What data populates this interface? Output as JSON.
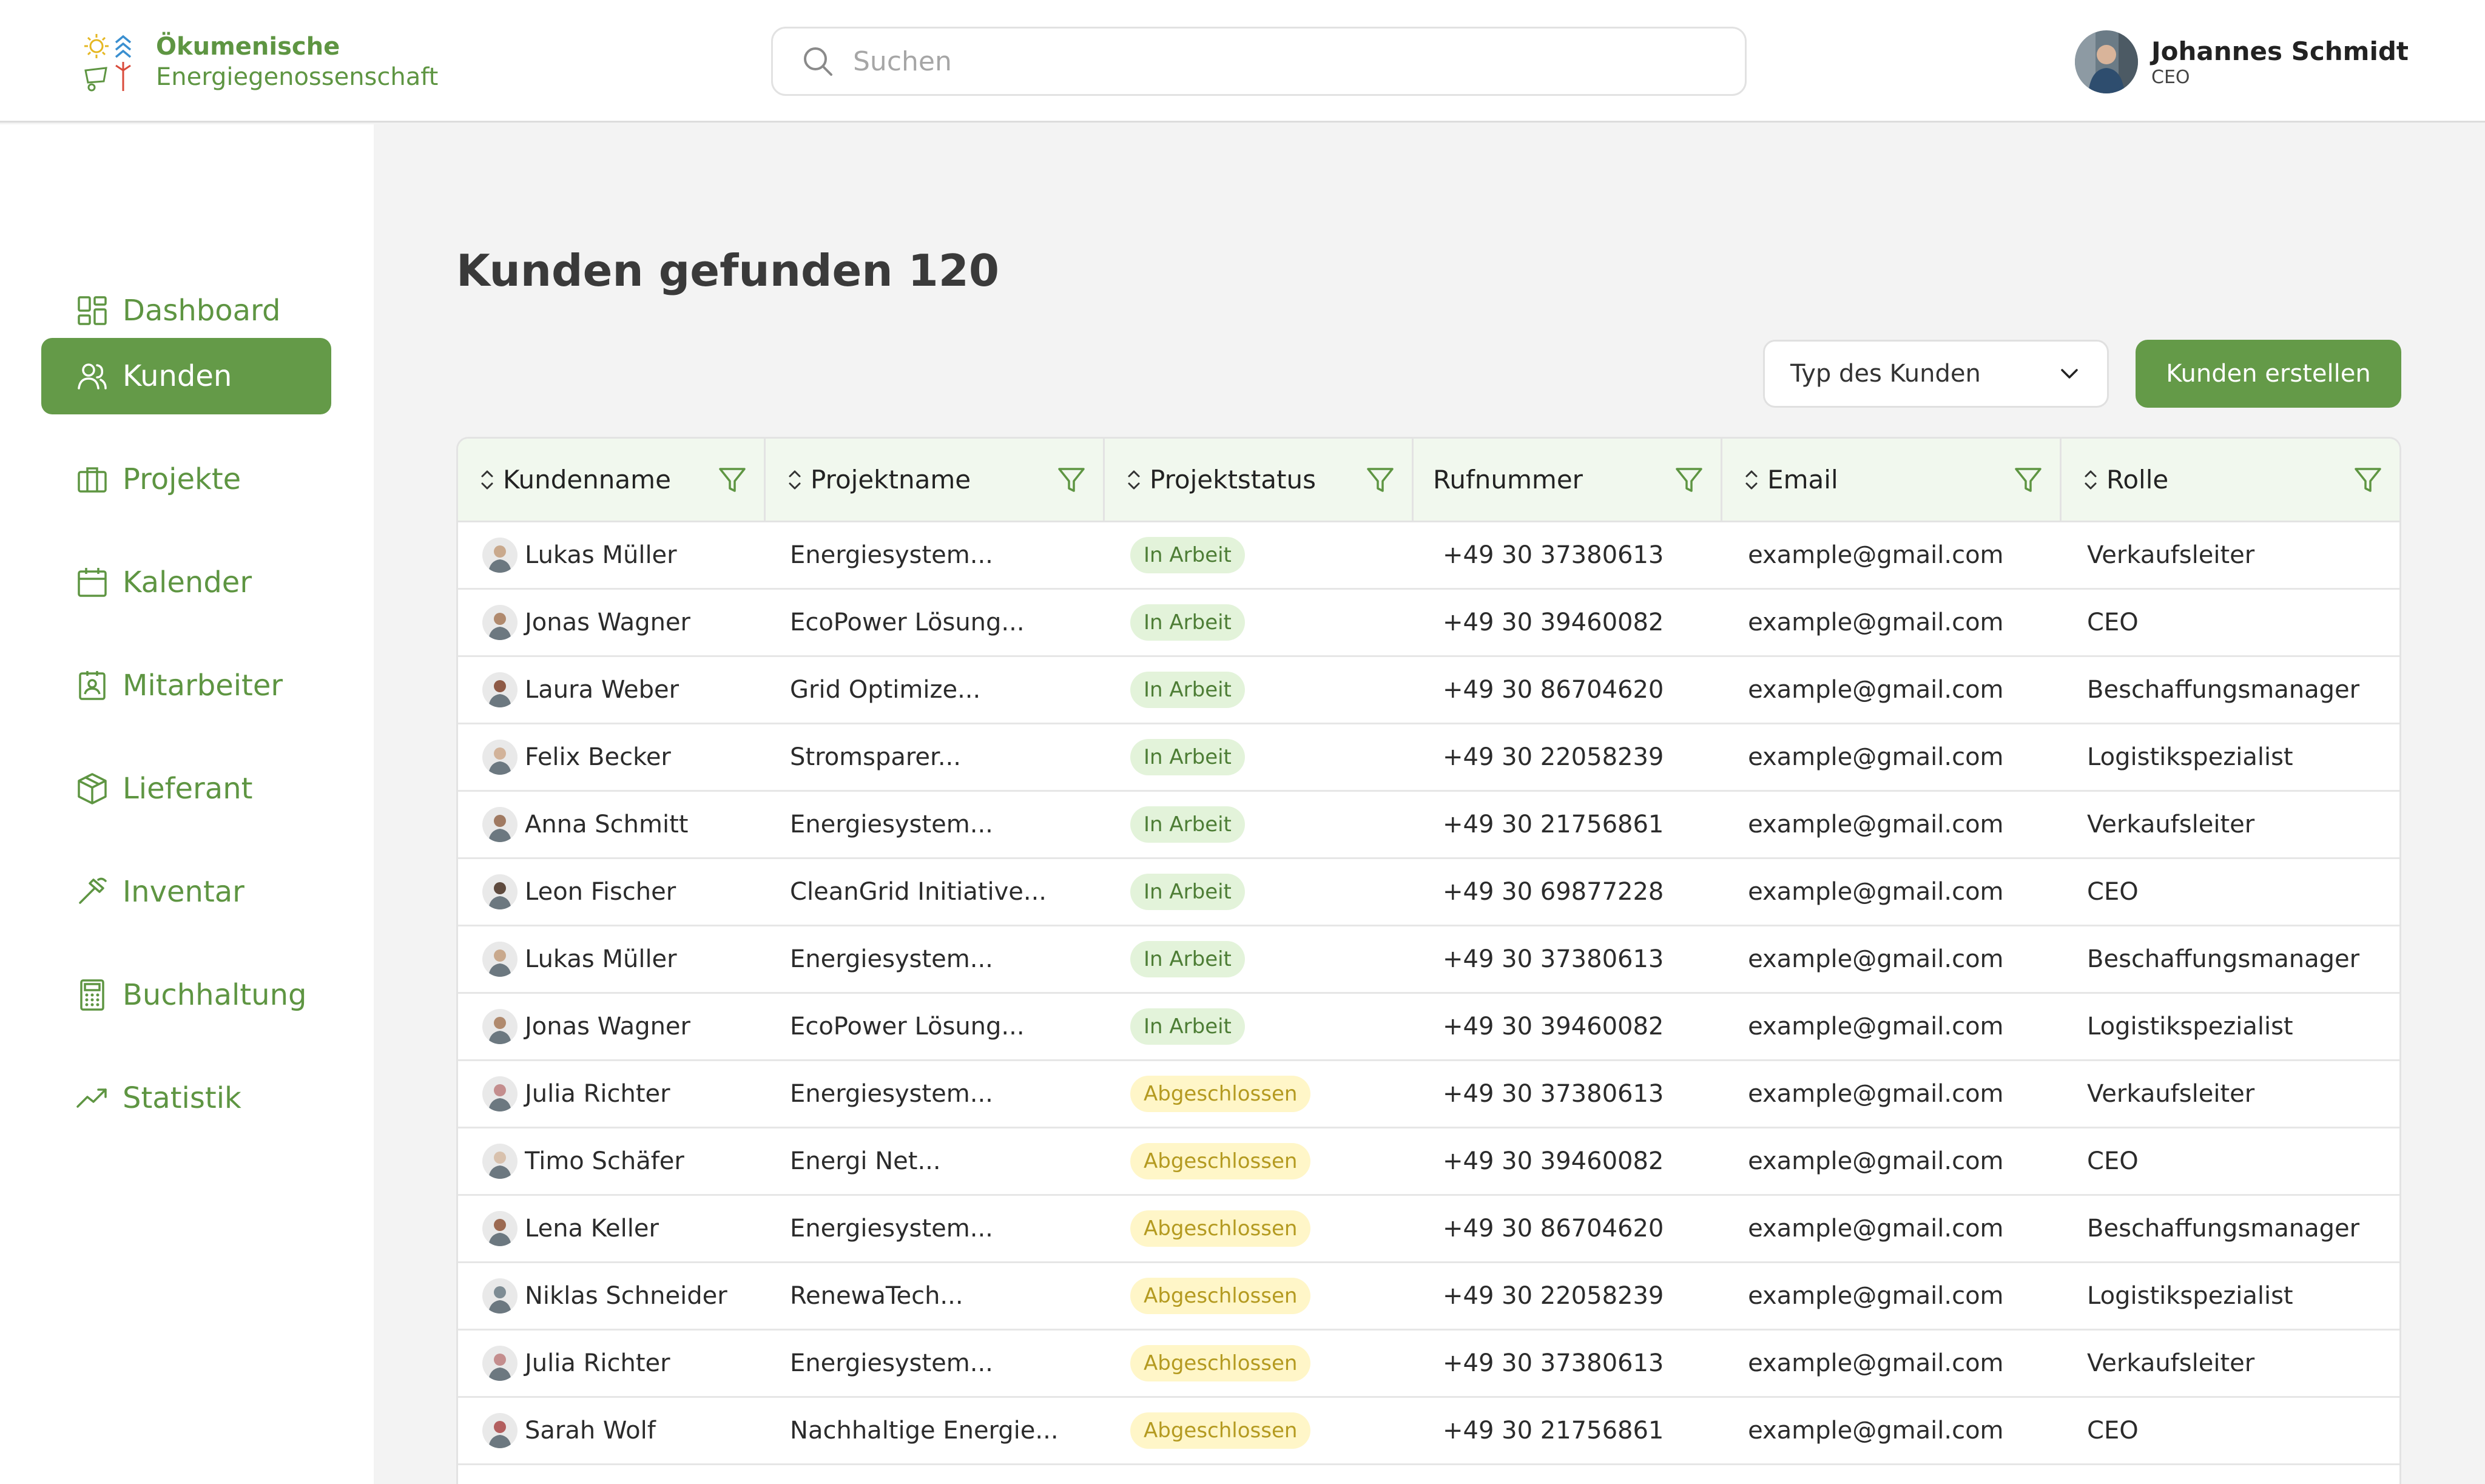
{
  "brand": {
    "line1": "Ökumenische",
    "line2": "Energiegenossenschaft"
  },
  "search": {
    "placeholder": "Suchen"
  },
  "user": {
    "name": "Johannes Schmidt",
    "role": "CEO"
  },
  "sidebar": {
    "items": [
      {
        "label": "Dashboard",
        "icon": "dashboard-icon",
        "active": false
      },
      {
        "label": "Kunden",
        "icon": "users-icon",
        "active": true
      },
      {
        "label": "Projekte",
        "icon": "briefcase-icon",
        "active": false
      },
      {
        "label": "Kalender",
        "icon": "calendar-icon",
        "active": false
      },
      {
        "label": "Mitarbeiter",
        "icon": "employee-badge-icon",
        "active": false
      },
      {
        "label": "Lieferant",
        "icon": "package-icon",
        "active": false
      },
      {
        "label": "Inventar",
        "icon": "hammer-icon",
        "active": false
      },
      {
        "label": "Buchhaltung",
        "icon": "calculator-icon",
        "active": false
      },
      {
        "label": "Statistik",
        "icon": "trend-up-icon",
        "active": false
      }
    ]
  },
  "main": {
    "title": "Kunden gefunden 120",
    "type_select_label": "Typ des Kunden",
    "create_button": "Kunden erstellen"
  },
  "table": {
    "columns": [
      "Kundenname",
      "Projektname",
      "Projektstatus",
      "Rufnummer",
      "Email",
      "Rolle"
    ],
    "rows": [
      {
        "name": "Lukas Müller",
        "project": "Energiesystem...",
        "status": "In Arbeit",
        "phone": "+49 30 37380613",
        "email": "example@gmail.com",
        "role": "Verkaufsleiter"
      },
      {
        "name": "Jonas Wagner",
        "project": "EcoPower Lösung...",
        "status": "In Arbeit",
        "phone": "+49 30 39460082",
        "email": "example@gmail.com",
        "role": "CEO"
      },
      {
        "name": "Laura Weber",
        "project": "Grid Optimize...",
        "status": "In Arbeit",
        "phone": "+49 30 86704620",
        "email": "example@gmail.com",
        "role": "Beschaffungsmanager"
      },
      {
        "name": "Felix Becker",
        "project": "Stromsparer...",
        "status": "In Arbeit",
        "phone": "+49 30 22058239",
        "email": "example@gmail.com",
        "role": "Logistikspezialist"
      },
      {
        "name": "Anna Schmitt",
        "project": "Energiesystem...",
        "status": "In Arbeit",
        "phone": "+49 30 21756861",
        "email": "example@gmail.com",
        "role": "Verkaufsleiter"
      },
      {
        "name": "Leon Fischer",
        "project": "CleanGrid Initiative...",
        "status": "In Arbeit",
        "phone": "+49 30 69877228",
        "email": "example@gmail.com",
        "role": "CEO"
      },
      {
        "name": "Lukas Müller",
        "project": "Energiesystem...",
        "status": "In Arbeit",
        "phone": "+49 30 37380613",
        "email": "example@gmail.com",
        "role": "Beschaffungsmanager"
      },
      {
        "name": "Jonas Wagner",
        "project": "EcoPower Lösung...",
        "status": "In Arbeit",
        "phone": "+49 30 39460082",
        "email": "example@gmail.com",
        "role": "Logistikspezialist"
      },
      {
        "name": "Julia Richter",
        "project": "Energiesystem...",
        "status": "Abgeschlossen",
        "phone": "+49 30 37380613",
        "email": "example@gmail.com",
        "role": "Verkaufsleiter"
      },
      {
        "name": "Timo Schäfer",
        "project": "Energi Net...",
        "status": "Abgeschlossen",
        "phone": "+49 30 39460082",
        "email": "example@gmail.com",
        "role": "CEO"
      },
      {
        "name": "Lena Keller",
        "project": "Energiesystem...",
        "status": "Abgeschlossen",
        "phone": "+49 30 86704620",
        "email": "example@gmail.com",
        "role": "Beschaffungsmanager"
      },
      {
        "name": "Niklas Schneider",
        "project": "RenewaTech...",
        "status": "Abgeschlossen",
        "phone": "+49 30 22058239",
        "email": "example@gmail.com",
        "role": "Logistikspezialist"
      },
      {
        "name": "Julia Richter",
        "project": "Energiesystem...",
        "status": "Abgeschlossen",
        "phone": "+49 30 37380613",
        "email": "example@gmail.com",
        "role": "Verkaufsleiter"
      },
      {
        "name": "Sarah Wolf",
        "project": "Nachhaltige Energie...",
        "status": "Abgeschlossen",
        "phone": "+49 30 21756861",
        "email": "example@gmail.com",
        "role": "CEO"
      }
    ]
  },
  "colors": {
    "accent": "#649a48",
    "accent_text": "#5e9542",
    "header_row_bg": "#f1f8ee",
    "badge_work_bg": "#e3f3da",
    "badge_done_bg": "#fff6c8"
  }
}
